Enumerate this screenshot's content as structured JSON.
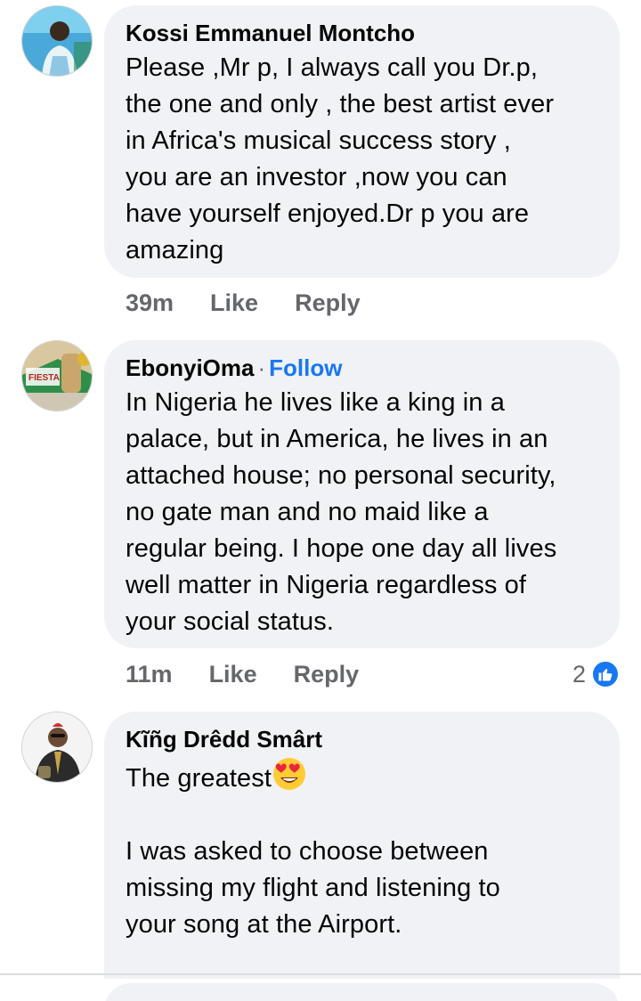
{
  "comments": [
    {
      "author": "Kossi Emmanuel Montcho",
      "text": "Please ,Mr p, I always call you Dr.p,\nthe one and only , the best artist ever\nin Africa's musical success story ,\nyou are an investor ,now you can\nhave yourself enjoyed.Dr p you are\namazing",
      "time": "39m",
      "like_label": "Like",
      "reply_label": "Reply"
    },
    {
      "author": "EbonyiOma",
      "separator": "·",
      "follow_label": "Follow",
      "text": "In Nigeria he lives like a king in a\npalace, but in America, he lives in an\nattached house; no personal security,\nno gate man and no maid like a\nregular being. I hope one day all lives\nwell matter in Nigeria regardless of\nyour social status.",
      "time": "11m",
      "like_label": "Like",
      "reply_label": "Reply",
      "reaction_count": "2",
      "reaction_icon": "like-thumb-icon",
      "avatar_text": "FIESTA"
    },
    {
      "author": "Kĩñg Drêdd Smârt",
      "text_first": "The greatest",
      "emoji": "heart-eyes-emoji",
      "text_rest": "I was asked to choose between\nmissing my flight and listening to\nyour song at the Airport."
    }
  ],
  "colors": {
    "bubble": "#f0f2f5",
    "secondary_text": "#65676b",
    "accent": "#1877f2"
  }
}
